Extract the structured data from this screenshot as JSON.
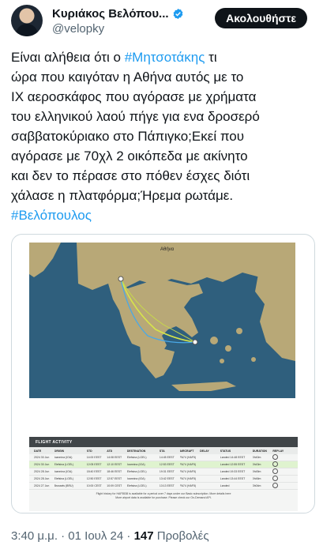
{
  "author": {
    "name": "Κυριάκος Βελόπου...",
    "handle": "@velopky",
    "follow_label": "Ακολουθήστε"
  },
  "tweet": {
    "lines": [
      {
        "pre": "Είναι αλήθεια ότι ο ",
        "tag": "#Μητσοτάκης",
        "post": " τι"
      },
      {
        "pre": "ώρα που καιγόταν η Αθήνα αυτός με το",
        "tag": "",
        "post": ""
      },
      {
        "pre": "ΙΧ αεροσκάφος που αγόρασε με χρήματα",
        "tag": "",
        "post": ""
      },
      {
        "pre": "του ελληνικού λαού πήγε για ενα δροσερό",
        "tag": "",
        "post": ""
      },
      {
        "pre": "σαββατοκύριακο στο Πάπιγκο;Εκεί που",
        "tag": "",
        "post": ""
      },
      {
        "pre": "αγόρασε με 70χλ 2 οικόπεδα με ακίνητο",
        "tag": "",
        "post": ""
      },
      {
        "pre": "και δεν το πέρασε στο πόθεν έσχες διότι",
        "tag": "",
        "post": ""
      },
      {
        "pre": "χάλασε η πλατφόρμα;Ήρεμα ρωτάμε.",
        "tag": "",
        "post": ""
      },
      {
        "pre": "",
        "tag": "#Βελόπουλος",
        "post": ""
      }
    ]
  },
  "media": {
    "map_label": "Αθήνα",
    "panel_title": "FLIGHT ACTIVITY",
    "columns": [
      "DATE",
      "ORIGIN",
      "STD",
      "ATD",
      "DESTINATION",
      "STA",
      "AIRCRAFT",
      "DELAY",
      "STATUS",
      "DURATION",
      "REPLAY"
    ],
    "rows": [
      {
        "cells": [
          "2024 30 Jun",
          "Ioannina (IOA)",
          "14:00 EEST",
          "14:08 EEST",
          "Elefsina (LGEL)",
          "14:45 EEST",
          "PA74 (HAF5)",
          "",
          "Landed 14:48 EEST",
          "0h40m",
          ""
        ],
        "highlight": false
      },
      {
        "cells": [
          "2024 30 Jun",
          "Elefsina (LGEL)",
          "12:05 EEST",
          "12:10 EEST",
          "Ioannina (IOA)",
          "12:53 EEST",
          "PA74 (HAF5)",
          "",
          "Landed 12:55 EEST",
          "0h43m",
          ""
        ],
        "highlight": true
      },
      {
        "cells": [
          "2024 28 Jun",
          "Ioannina (IOA)",
          "18:40 EEST",
          "18:46 EEST",
          "Elefsina (LGEL)",
          "19:31 EEST",
          "PA74 (HAF5)",
          "",
          "Landed 19:33 EEST",
          "0h45m",
          ""
        ],
        "highlight": false
      },
      {
        "cells": [
          "2024 28 Jun",
          "Elefsina (LGEL)",
          "12:50 EEST",
          "12:57 EEST",
          "Ioannina (IOA)",
          "13:42 EEST",
          "PA74 (HAF5)",
          "",
          "Landed 13:44 EEST",
          "0h46m",
          ""
        ],
        "highlight": false
      },
      {
        "cells": [
          "2024 27 Jun",
          "Brussels (BRU)",
          "10:00 CEST",
          "10:09 CEST",
          "Elefsina (LGEL)",
          "13:13 EEST",
          "PA74 (HAF5)",
          "",
          "Landed",
          "3h04m",
          ""
        ],
        "highlight": false
      }
    ],
    "footer_line1": "Flight history for HAF5538 is available for a period over 7 days under our Basic subscription. More details here",
    "footer_line2": "More airport data is available for purchase. Please check our On-Demand API."
  },
  "meta": {
    "time_date": "3:40 μ.μ. · 01 Ιουλ 24 · ",
    "views_count": "147",
    "views_label": " Προβολές"
  },
  "colors": {
    "hashtag": "#1d9bf0",
    "verified": "#1d9bf0",
    "follow_bg": "#0f1419",
    "sea": "#2f5f7d",
    "land": "#b8a877",
    "flight_path": "#d7e64a"
  }
}
